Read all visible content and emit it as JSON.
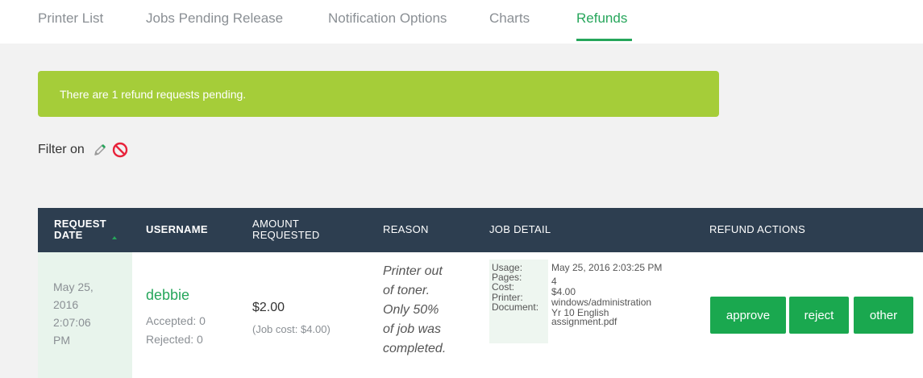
{
  "tabs": [
    {
      "label": "Printer List"
    },
    {
      "label": "Jobs Pending Release"
    },
    {
      "label": "Notification Options"
    },
    {
      "label": "Charts"
    },
    {
      "label": "Refunds"
    }
  ],
  "active_tab": "Refunds",
  "accent_color": "#26a65b",
  "alert": {
    "text": "There are 1 refund requests pending.",
    "color": "#a5cd39"
  },
  "filter": {
    "label": "Filter on",
    "icons": [
      "pencil-icon",
      "clear-filter-icon"
    ]
  },
  "table": {
    "headers": {
      "request_date_l1": "REQUEST",
      "request_date_l2": "DATE",
      "username": "USERNAME",
      "amount_l1": "AMOUNT",
      "amount_l2": "REQUESTED",
      "reason": "REASON",
      "job_detail": "JOB DETAIL",
      "refund_actions": "REFUND ACTIONS"
    },
    "rows": [
      {
        "date_lines": [
          "May 25,",
          "2016",
          "2:07:06",
          "PM"
        ],
        "username": "debbie",
        "accepted": "Accepted: 0",
        "rejected": "Rejected: 0",
        "amount": "$2.00",
        "job_cost": "(Job cost: $4.00)",
        "reason_lines": [
          "Printer out",
          "of toner.",
          "Only 50%",
          "of job was",
          "completed."
        ],
        "detail_labels": [
          "Usage:",
          "Pages:",
          "Cost:",
          "Printer:",
          "Document:"
        ],
        "detail_values": [
          "May 25, 2016 2:03:25 PM",
          "4",
          "$4.00",
          "windows/administration",
          "Yr 10 English",
          "assignment.pdf"
        ],
        "actions": [
          "approve",
          "reject",
          "other"
        ]
      }
    ]
  }
}
